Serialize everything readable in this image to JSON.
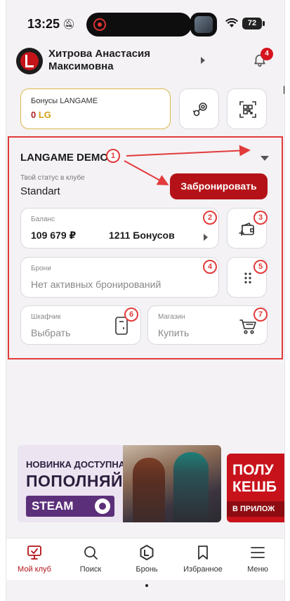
{
  "status_bar": {
    "time": "13:25",
    "battery": "72"
  },
  "header": {
    "user_name": "Хитрова Анастасия Максимовна",
    "notification_count": "4"
  },
  "bonus_card": {
    "title": "Бонусы LANGAME",
    "amount": "0",
    "unit": "LG"
  },
  "club": {
    "name": "LANGAME DEMO",
    "status_label": "Твой статус в клубе",
    "status_value": "Standart",
    "book_button": "Забронировать"
  },
  "balance": {
    "label": "Баланс",
    "money": "109 679 ₽",
    "bonuses": "1211 Бонусов"
  },
  "bookings": {
    "label": "Брони",
    "value": "Нет активных бронирований"
  },
  "locker": {
    "label": "Шкафчик",
    "value": "Выбрать"
  },
  "shop": {
    "label": "Магазин",
    "value": "Купить"
  },
  "markers": [
    "1",
    "2",
    "3",
    "4",
    "5",
    "6",
    "7"
  ],
  "banners": {
    "steam": {
      "line1": "НОВИНКА ДОСТУПНА!",
      "line2": "ПОПОЛНЯЙ",
      "line3": "STEAM"
    },
    "cashback": {
      "line1": "ПОЛУ",
      "line2": "КЕШБ",
      "line3": "В ПРИЛОЖ"
    }
  },
  "nav": [
    {
      "label": "Мой клуб",
      "icon": "monitor-icon",
      "active": true
    },
    {
      "label": "Поиск",
      "icon": "search-icon",
      "active": false
    },
    {
      "label": "Бронь",
      "icon": "langame-logo-icon",
      "active": false
    },
    {
      "label": "Избранное",
      "icon": "bookmark-icon",
      "active": false
    },
    {
      "label": "Меню",
      "icon": "menu-icon",
      "active": false
    }
  ],
  "colors": {
    "accent": "#b41218",
    "annotation": "#e23b3b",
    "gold": "#d4a017"
  }
}
